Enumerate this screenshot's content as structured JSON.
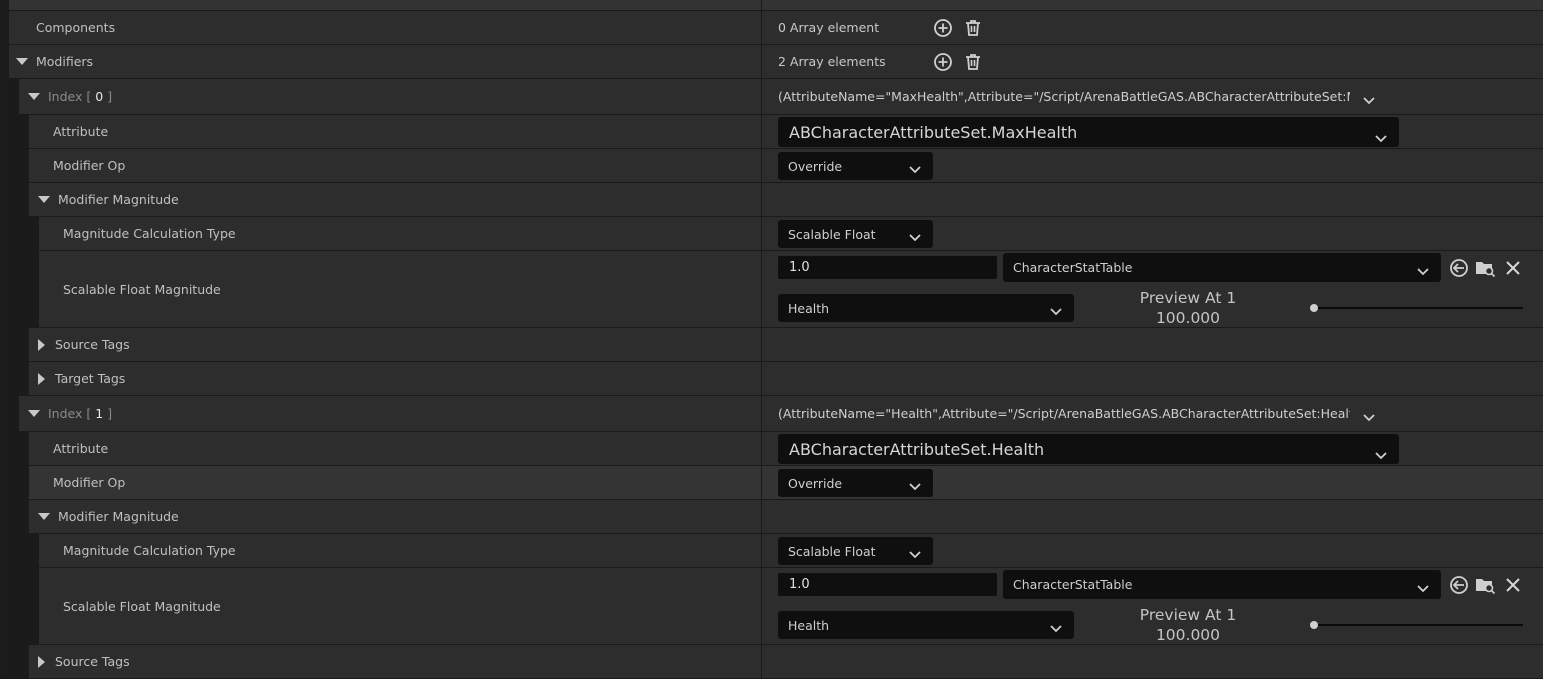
{
  "rows": {
    "components": {
      "label": "Components",
      "value": "0 Array element"
    },
    "modifiers": {
      "label": "Modifiers",
      "value": "2 Array elements"
    },
    "attribute_label": "Attribute",
    "modifier_op_label": "Modifier Op",
    "modifier_magnitude_label": "Modifier Magnitude",
    "calc_type_label": "Magnitude Calculation Type",
    "scalable_float_label": "Scalable Float Magnitude",
    "source_tags_label": "Source Tags",
    "target_tags_label": "Target Tags"
  },
  "index_prefix": "Index",
  "index_open": "[",
  "index_close": "]",
  "elements": [
    {
      "index": "0",
      "summary": "(AttributeName=\"MaxHealth\",Attribute=\"/Script/ArenaBattleGAS.ABCharacterAttributeSet:MaxHealth\"",
      "attribute": "ABCharacterAttributeSet.MaxHealth",
      "modifier_op": "Override",
      "calc_type": "Scalable Float",
      "scalable_value": "1.0",
      "curve_table": "CharacterStatTable",
      "row_name": "Health",
      "preview_label": "Preview At 1",
      "preview_value": "100.000",
      "preview_level": 0.0
    },
    {
      "index": "1",
      "summary": "(AttributeName=\"Health\",Attribute=\"/Script/ArenaBattleGAS.ABCharacterAttributeSet:Health\",Attribute",
      "attribute": "ABCharacterAttributeSet.Health",
      "modifier_op": "Override",
      "calc_type": "Scalable Float",
      "scalable_value": "1.0",
      "curve_table": "CharacterStatTable",
      "row_name": "Health",
      "preview_label": "Preview At 1",
      "preview_value": "100.000",
      "preview_level": 0.0
    }
  ],
  "icons": {
    "add": "plus-circle-icon",
    "delete": "trash-icon",
    "reset": "reset-to-default-icon",
    "browse": "browse-asset-icon",
    "clear": "close-icon"
  },
  "colors": {
    "panel": "#2d2d2d",
    "input": "#0f0f0f",
    "text": "#c0c0c0"
  }
}
